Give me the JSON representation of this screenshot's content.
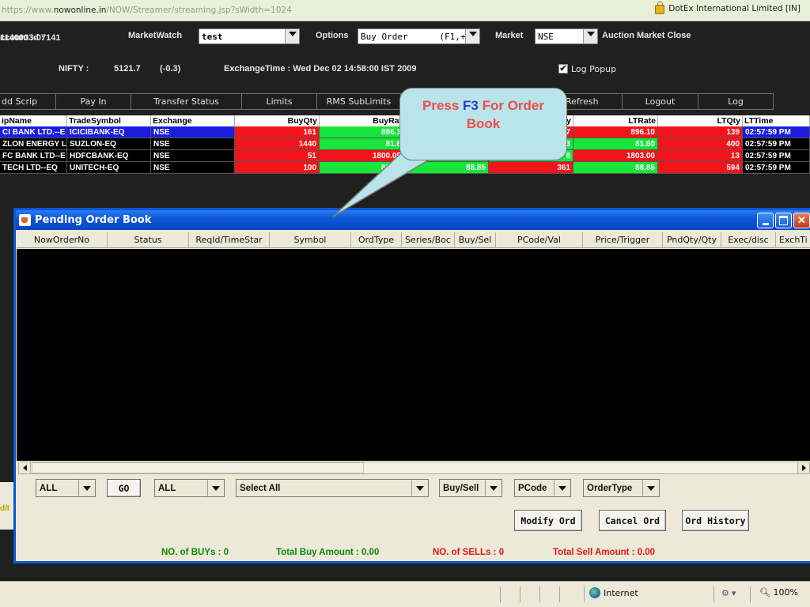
{
  "browser": {
    "url_prefix": "https://www.",
    "url_domain": "nowonline.in",
    "url_path": "/NOW/Streamer/streaming.jsp?sWidth=1024",
    "site_identity": "DotEx International Limited [IN]"
  },
  "header": {
    "account_label": "ccount Id :",
    "account_id": "1140003-07141",
    "marketwatch_label": "MarketWatch",
    "marketwatch_value": "test",
    "options_label": "Options",
    "options_value": "Buy Order      (F1,+)",
    "market_label": "Market",
    "market_value": "NSE",
    "market_status": "Auction Market Close",
    "nifty_label": "NIFTY :",
    "nifty_value": "5121.7",
    "nifty_change": "(-0.3)",
    "exchange_time": "ExchangeTime : Wed Dec 02 14:58:00 IST 2009",
    "log_popup_label": "Log Popup",
    "log_popup_checked": true
  },
  "toolbar": {
    "add_scrip": "dd Scrip",
    "pay_in": "Pay In",
    "transfer_status": "Transfer Status",
    "limits": "Limits",
    "rms_sublimits": "RMS SubLimits",
    "refresh": "Refresh",
    "logout": "Logout",
    "log": "Log"
  },
  "market_watch": {
    "columns": {
      "scrip_name": "ipName",
      "trade_symbol": "TradeSymbol",
      "exchange": "Exchange",
      "buy_qty": "BuyQty",
      "buy_rate": "BuyRat",
      "sell_qty_tail": "y",
      "lt_rate": "LTRate",
      "lt_qty": "LTQty",
      "lt_time": "LTTime"
    },
    "rows": [
      {
        "name": "CI BANK LTD.--E",
        "symbol": "ICICIBANK-EQ",
        "exchange": "NSE",
        "buy_qty": "161",
        "buy_rate": "896.1",
        "sell_rate": "",
        "sell_qty": "7",
        "lt_rate": "896.10",
        "lt_qty": "139",
        "lt_time": "02:57:59 PM"
      },
      {
        "name": "ZLON ENERGY L",
        "symbol": "SUZLON-EQ",
        "exchange": "NSE",
        "buy_qty": "1440",
        "buy_rate": "81.6",
        "sell_rate": "",
        "sell_qty": "3",
        "lt_rate": "81.60",
        "lt_qty": "400",
        "lt_time": "02:57:59 PM"
      },
      {
        "name": "FC BANK LTD--E",
        "symbol": "HDFCBANK-EQ",
        "exchange": "NSE",
        "buy_qty": "51",
        "buy_rate": "1800.05",
        "sell_rate": "",
        "sell_qty": "8",
        "lt_rate": "1803.00",
        "lt_qty": "13",
        "lt_time": "02:57:59 PM"
      },
      {
        "name": "TECH LTD--EQ",
        "symbol": "UNITECH-EQ",
        "exchange": "NSE",
        "buy_qty": "100",
        "buy_rate": "88.80",
        "sell_rate": "88.85",
        "sell_qty": "361",
        "lt_rate": "88.85",
        "lt_qty": "594",
        "lt_time": "02:57:59 PM"
      }
    ]
  },
  "callout": {
    "prefix": "Press ",
    "key": "F3",
    "suffix": " For Order",
    "line2": "Book"
  },
  "pending_window": {
    "title": "Pending Order Book",
    "columns": [
      "NowOrderNo",
      "Status",
      "ReqId/TimeStar",
      "Symbol",
      "OrdType",
      "Series/Boc",
      "Buy/Sel",
      "PCode/Val",
      "Price/Trigger",
      "PndQty/Qty",
      "Exec/disc",
      "ExchTi"
    ],
    "filters": {
      "filter1": "ALL",
      "go": "GO",
      "filter2": "ALL",
      "scrip_select": "Select All",
      "side": "Buy/Sell",
      "pcode": "PCode",
      "ordertype": "OrderType"
    },
    "buttons": {
      "modify": "Modify Ord",
      "cancel": "Cancel Ord",
      "history": "Ord History"
    },
    "summary": {
      "buys": "NO. of BUYs : 0",
      "total_buy": "Total Buy Amount  : 0.00",
      "sells": "NO. of SELLs  : 0",
      "total_sell": "Total Sell Amount  : 0.00"
    }
  },
  "left_strip_text": "d/I",
  "statusbar": {
    "zone": "Internet",
    "zoom": "100%"
  },
  "colors": {
    "buy_red": "#f2141a",
    "sell_green": "#17e63a",
    "selected_blue": "#1c1ce0",
    "callout_fill": "#b8e4ea",
    "callout_text": "#f14a4a",
    "callout_key": "#2b3fc4",
    "window_title": "#0a55d8"
  }
}
